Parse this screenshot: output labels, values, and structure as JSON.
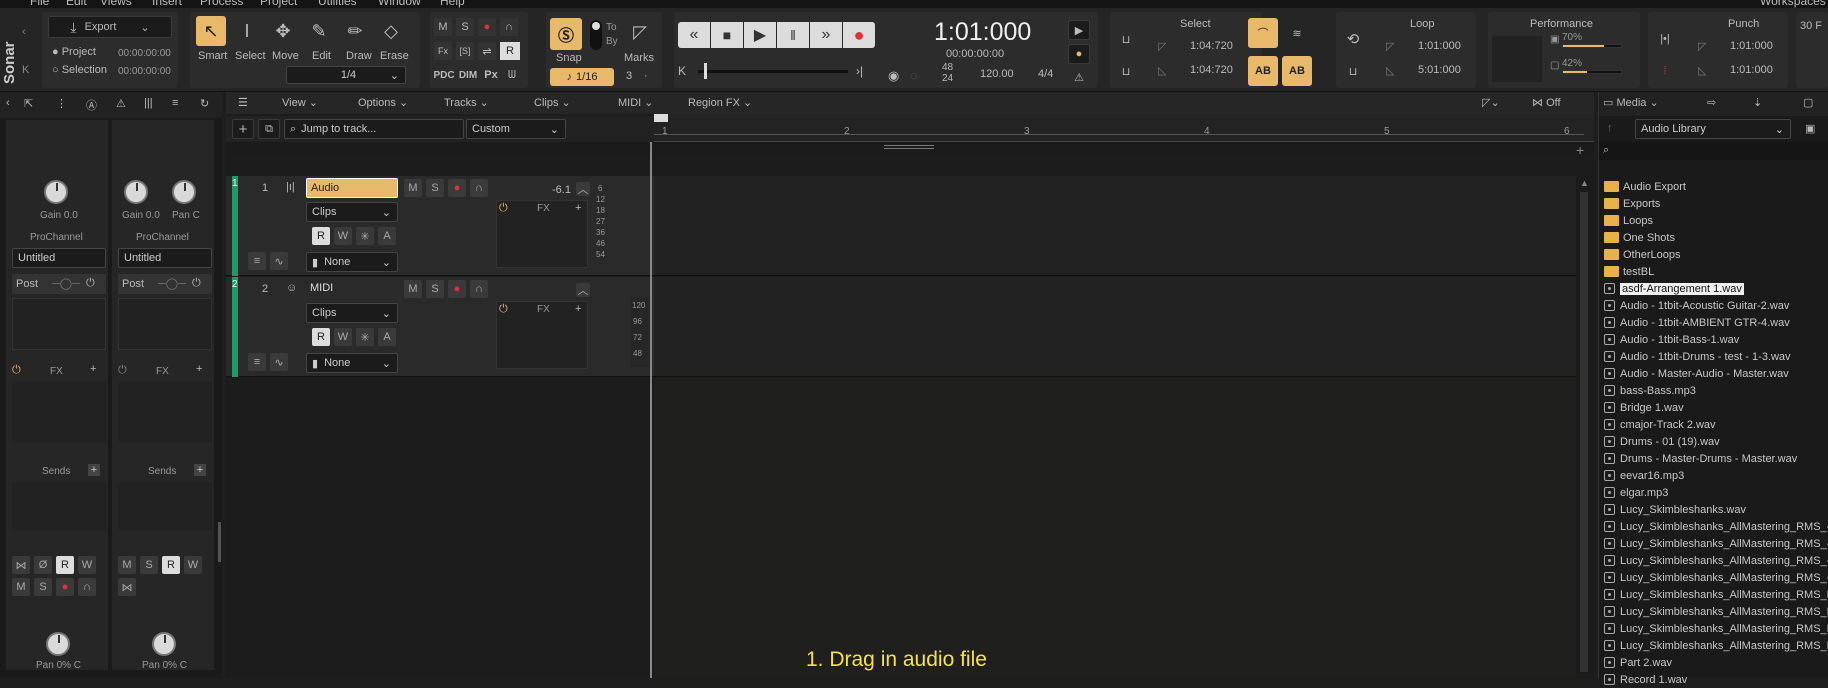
{
  "menu": {
    "items": [
      "File",
      "Edit",
      "Views",
      "Insert",
      "Process",
      "Project",
      "Utilities",
      "Window",
      "Help"
    ],
    "right": "Workspaces"
  },
  "app": {
    "name": "Sonar"
  },
  "export": {
    "label": "Export",
    "project": "Project",
    "selection": "Selection",
    "time1": "00:00:00:00",
    "time2": "00:00:00:00"
  },
  "tools": {
    "smart": "Smart",
    "select": "Select",
    "move": "Move",
    "edit": "Edit",
    "draw": "Draw",
    "erase": "Erase",
    "snap_division": "1/4"
  },
  "mix": {
    "m": "M",
    "s": "S",
    "r": "R",
    "pdc": "PDC",
    "dim": "DIM",
    "px": "Px",
    "fx": "Fx",
    "s_bracket": "[S]"
  },
  "snap": {
    "label": "Snap",
    "marks": "Marks",
    "to": "To",
    "by": "By",
    "value": "1/16",
    "count": "3"
  },
  "transport": {
    "time": "1:01:000",
    "smpte": "00:00:00:00",
    "timesig_top": "48",
    "timesig_bot": "24",
    "tempo": "120.00",
    "meter": "4/4"
  },
  "select": {
    "title": "Select",
    "start": "1:04:720",
    "end": "1:04:720"
  },
  "loop": {
    "title": "Loop",
    "start": "1:01:000",
    "end": "5:01:000"
  },
  "performance": {
    "title": "Performance",
    "cpu": "70%",
    "disk": "42%",
    "cpu_level": 0.7,
    "disk_level": 0.42
  },
  "punch": {
    "title": "Punch",
    "start": "1:01:000",
    "end": "1:01:000"
  },
  "extra": {
    "right": "30 F"
  },
  "track_menu": {
    "view": "View",
    "options": "Options",
    "tracks": "Tracks",
    "clips": "Clips",
    "midi": "MIDI",
    "regionfx": "Region FX",
    "off": "Off"
  },
  "jump": {
    "placeholder": "Jump to track...",
    "preset": "Custom"
  },
  "ruler": {
    "marks": [
      "1",
      "2",
      "3",
      "4",
      "5",
      "6"
    ]
  },
  "inspector": {
    "gain1": "Gain 0.0",
    "gain2": "Gain 0.0",
    "pan": "Pan C",
    "prochannel": "ProChannel",
    "untitled": "Untitled",
    "post": "Post",
    "fx": "FX",
    "sends": "Sends",
    "pan_bottom": "Pan 0% C",
    "m": "M",
    "s": "S",
    "r": "R",
    "w": "W",
    "o": "Ø"
  },
  "tracks": [
    {
      "num": "1",
      "name": "Audio",
      "clips": "Clips",
      "input": "None",
      "db": "-6.1",
      "fx": "FX",
      "m": "M",
      "s": "S",
      "r": "R",
      "w": "W",
      "a": "A"
    },
    {
      "num": "2",
      "name": "MIDI",
      "clips": "Clips",
      "input": "None",
      "fx": "FX",
      "m": "M",
      "s": "S",
      "r": "R",
      "w": "W",
      "a": "A"
    }
  ],
  "meter_scale_1": [
    "6",
    "12",
    "18",
    "27",
    "36",
    "46",
    "54"
  ],
  "meter_scale_2": [
    "120",
    "96",
    "72",
    "48"
  ],
  "media": {
    "tab": "Media",
    "library": "Audio Library",
    "items": [
      {
        "type": "folder",
        "name": "Audio Export"
      },
      {
        "type": "folder",
        "name": "Exports"
      },
      {
        "type": "folder",
        "name": "Loops"
      },
      {
        "type": "folder",
        "name": "One Shots"
      },
      {
        "type": "folder",
        "name": "OtherLoops"
      },
      {
        "type": "folder",
        "name": "testBL"
      },
      {
        "type": "file",
        "name": "asdf-Arrangement 1.wav",
        "selected": true
      },
      {
        "type": "file",
        "name": "Audio - 1tbit-Acoustic Guitar-2.wav"
      },
      {
        "type": "file",
        "name": "Audio - 1tbit-AMBIENT GTR-4.wav"
      },
      {
        "type": "file",
        "name": "Audio - 1tbit-Bass-1.wav"
      },
      {
        "type": "file",
        "name": "Audio - 1tbit-Drums - test - 1-3.wav"
      },
      {
        "type": "file",
        "name": "Audio - Master-Audio - Master.wav"
      },
      {
        "type": "file",
        "name": "bass-Bass.mp3"
      },
      {
        "type": "file",
        "name": "Bridge 1.wav"
      },
      {
        "type": "file",
        "name": "cmajor-Track 2.wav"
      },
      {
        "type": "file",
        "name": "Drums - 01 (19).wav"
      },
      {
        "type": "file",
        "name": "Drums - Master-Drums - Master.wav"
      },
      {
        "type": "file",
        "name": "eevar16.mp3"
      },
      {
        "type": "file",
        "name": "elgar.mp3"
      },
      {
        "type": "file",
        "name": "Lucy_Skimbleshanks.wav"
      },
      {
        "type": "file",
        "name": "Lucy_Skimbleshanks_AllMastering_RMS_-"
      },
      {
        "type": "file",
        "name": "Lucy_Skimbleshanks_AllMastering_RMS_-"
      },
      {
        "type": "file",
        "name": "Lucy_Skimbleshanks_AllMastering_RMS_-"
      },
      {
        "type": "file",
        "name": "Lucy_Skimbleshanks_AllMastering_RMS_-"
      },
      {
        "type": "file",
        "name": "Lucy_Skimbleshanks_AllMastering_RMS_M"
      },
      {
        "type": "file",
        "name": "Lucy_Skimbleshanks_AllMastering_RMS_M"
      },
      {
        "type": "file",
        "name": "Lucy_Skimbleshanks_AllMastering_RMS_N"
      },
      {
        "type": "file",
        "name": "Lucy_Skimbleshanks_AllMastering_RMS_N"
      },
      {
        "type": "file",
        "name": "Part 2.wav"
      },
      {
        "type": "file",
        "name": "Record 1.wav"
      }
    ]
  },
  "caption": "1. Drag in audio file",
  "colors": {
    "accent": "#e8b96a",
    "record": "#e0303a",
    "track_strip": "#1f9a68",
    "caption": "#f4e24a"
  }
}
